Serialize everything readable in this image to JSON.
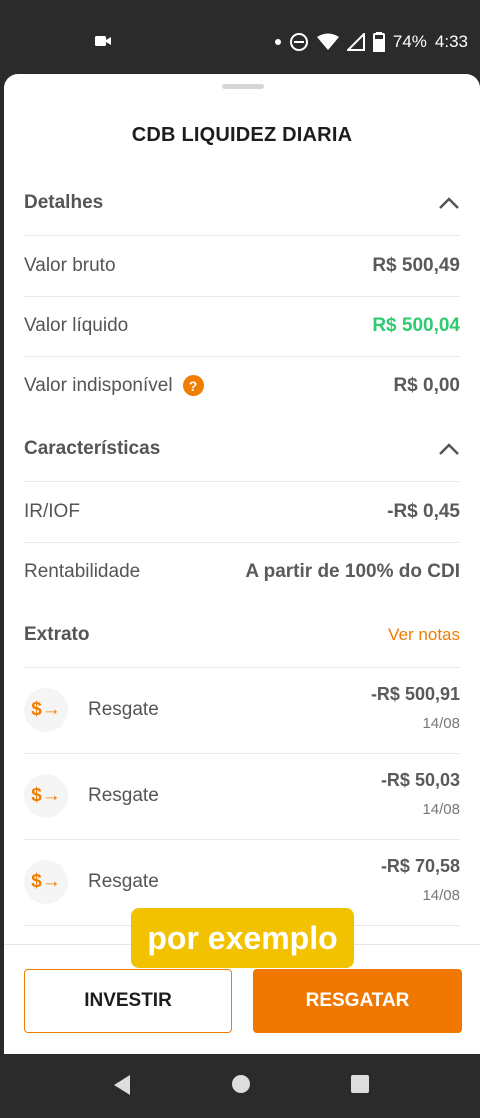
{
  "status_bar": {
    "battery": "74%",
    "time": "4:33",
    "icons": [
      "video-camera-icon",
      "dot-icon",
      "do-not-disturb-icon",
      "wifi-icon",
      "signal-icon",
      "battery-icon"
    ]
  },
  "title": "CDB LIQUIDEZ DIARIA",
  "sections": {
    "detalhes": {
      "label": "Detalhes",
      "rows": [
        {
          "label": "Valor bruto",
          "value": "R$ 500,49"
        },
        {
          "label": "Valor líquido",
          "value": "R$ 500,04"
        },
        {
          "label": "Valor indisponível",
          "value": "R$ 0,00",
          "help": "?"
        }
      ]
    },
    "caracteristicas": {
      "label": "Características",
      "rows": [
        {
          "label": "IR/IOF",
          "value": "-R$ 0,45"
        },
        {
          "label": "Rentabilidade",
          "value": "A partir de 100% do CDI"
        }
      ]
    },
    "extrato": {
      "label": "Extrato",
      "link": "Ver notas",
      "transactions": [
        {
          "icon_text": "$→",
          "name": "Resgate",
          "amount": "-R$ 500,91",
          "date": "14/08"
        },
        {
          "icon_text": "$→",
          "name": "Resgate",
          "amount": "-R$ 50,03",
          "date": "14/08"
        },
        {
          "icon_text": "$→",
          "name": "Resgate",
          "amount": "-R$ 70,58",
          "date": "14/08"
        }
      ]
    }
  },
  "buttons": {
    "invest": "INVESTIR",
    "resgatar": "RESGATAR"
  },
  "caption": "por exemplo",
  "colors": {
    "accent": "#ef7d00",
    "positive": "#2ecc71",
    "caption_bg": "#f2c200"
  }
}
